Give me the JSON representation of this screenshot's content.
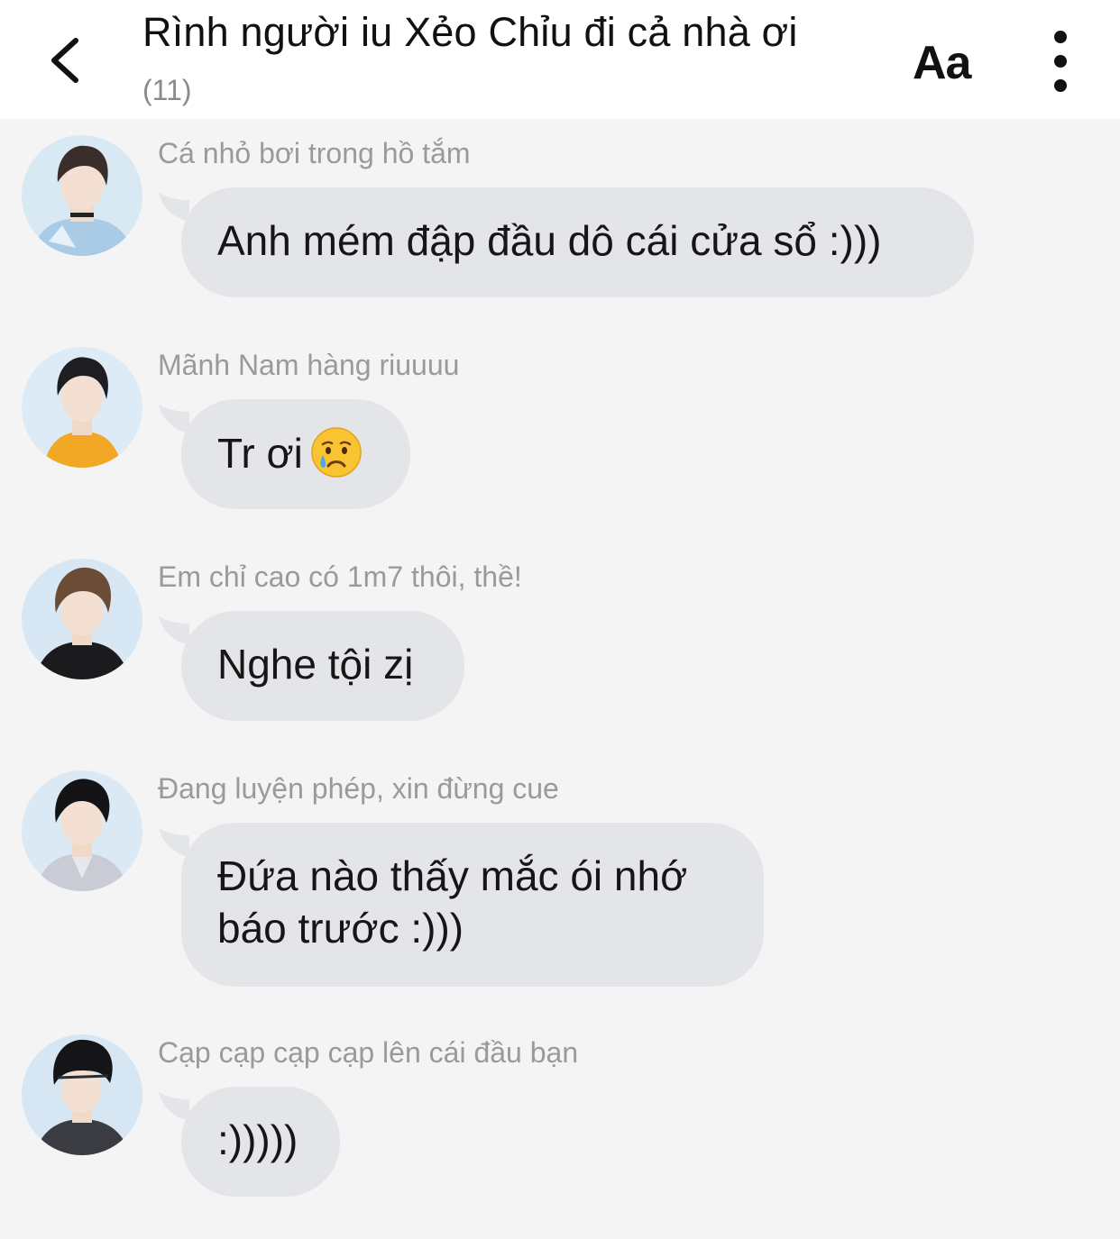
{
  "header": {
    "title": "Rình người iu Xẻo Chỉu đi cả nhà ơi",
    "member_count": "(11)",
    "font_button": "Aa"
  },
  "messages": [
    {
      "sender": "Cá nhỏ bơi trong hồ tắm",
      "text": "Anh mém đập đầu dô cái cửa sổ :)))"
    },
    {
      "sender": "Mãnh Nam hàng riuuuu",
      "text": "Tr ơi",
      "emoji": "crying-face-emoji"
    },
    {
      "sender": "Em chỉ cao có 1m7 thôi, thề!",
      "text": "Nghe tội zị"
    },
    {
      "sender": "Đang luyện phép, xin đừng cue",
      "text_line1": "Đứa nào thấy mắc ói nhớ",
      "text_line2": "báo trước :)))"
    },
    {
      "sender": "Cạp cạp cạp cạp lên cái đầu bạn",
      "text": ":)))))"
    }
  ],
  "colors": {
    "background": "#f4f4f4",
    "header": "#ffffff",
    "bubble": "#e3e5e8",
    "sender_text": "#9a9a9a",
    "message_text": "#161616"
  }
}
